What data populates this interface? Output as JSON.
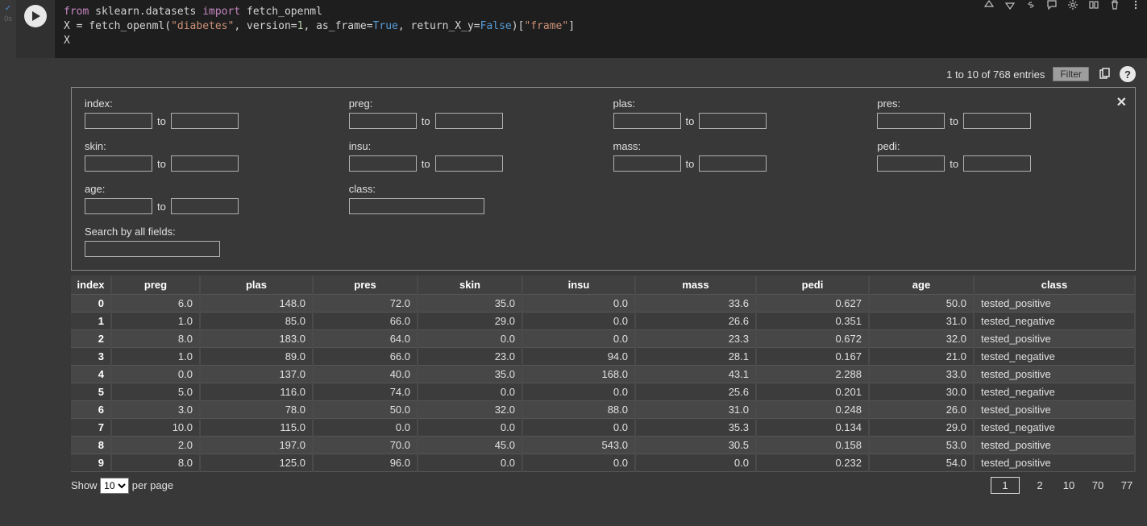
{
  "gutter": {
    "check": "✓",
    "time": "0s"
  },
  "code": {
    "line1_pre": "from",
    "line1_mod": " sklearn.datasets ",
    "line1_imp": "import",
    "line1_fn": " fetch_openml",
    "line2_a": "X = fetch_openml(",
    "line2_s1": "\"diabetes\"",
    "line2_b": ", version=",
    "line2_n1": "1",
    "line2_c": ", as_frame=",
    "line2_t": "True",
    "line2_d": ", return_X_y=",
    "line2_f": "False",
    "line2_e": ")[",
    "line2_s2": "\"frame\"",
    "line2_g": "]",
    "line3": "X"
  },
  "output_header": {
    "entries_text": "1 to 10 of 768 entries",
    "filter_label": "Filter"
  },
  "filters": {
    "range_labels": [
      "index:",
      "preg:",
      "plas:",
      "pres:",
      "skin:",
      "insu:",
      "mass:",
      "pedi:",
      "age:"
    ],
    "to_label": "to",
    "single_labels": [
      "class:"
    ],
    "search_label": "Search by all fields:"
  },
  "table": {
    "columns": [
      "index",
      "preg",
      "plas",
      "pres",
      "skin",
      "insu",
      "mass",
      "pedi",
      "age",
      "class"
    ],
    "col_widths": [
      "50px",
      "110px",
      "140px",
      "130px",
      "130px",
      "140px",
      "150px",
      "140px",
      "130px",
      ""
    ],
    "rows": [
      {
        "index": "0",
        "preg": "6.0",
        "plas": "148.0",
        "pres": "72.0",
        "skin": "35.0",
        "insu": "0.0",
        "mass": "33.6",
        "pedi": "0.627",
        "age": "50.0",
        "class": "tested_positive"
      },
      {
        "index": "1",
        "preg": "1.0",
        "plas": "85.0",
        "pres": "66.0",
        "skin": "29.0",
        "insu": "0.0",
        "mass": "26.6",
        "pedi": "0.351",
        "age": "31.0",
        "class": "tested_negative"
      },
      {
        "index": "2",
        "preg": "8.0",
        "plas": "183.0",
        "pres": "64.0",
        "skin": "0.0",
        "insu": "0.0",
        "mass": "23.3",
        "pedi": "0.672",
        "age": "32.0",
        "class": "tested_positive"
      },
      {
        "index": "3",
        "preg": "1.0",
        "plas": "89.0",
        "pres": "66.0",
        "skin": "23.0",
        "insu": "94.0",
        "mass": "28.1",
        "pedi": "0.167",
        "age": "21.0",
        "class": "tested_negative"
      },
      {
        "index": "4",
        "preg": "0.0",
        "plas": "137.0",
        "pres": "40.0",
        "skin": "35.0",
        "insu": "168.0",
        "mass": "43.1",
        "pedi": "2.288",
        "age": "33.0",
        "class": "tested_positive"
      },
      {
        "index": "5",
        "preg": "5.0",
        "plas": "116.0",
        "pres": "74.0",
        "skin": "0.0",
        "insu": "0.0",
        "mass": "25.6",
        "pedi": "0.201",
        "age": "30.0",
        "class": "tested_negative"
      },
      {
        "index": "6",
        "preg": "3.0",
        "plas": "78.0",
        "pres": "50.0",
        "skin": "32.0",
        "insu": "88.0",
        "mass": "31.0",
        "pedi": "0.248",
        "age": "26.0",
        "class": "tested_positive"
      },
      {
        "index": "7",
        "preg": "10.0",
        "plas": "115.0",
        "pres": "0.0",
        "skin": "0.0",
        "insu": "0.0",
        "mass": "35.3",
        "pedi": "0.134",
        "age": "29.0",
        "class": "tested_negative"
      },
      {
        "index": "8",
        "preg": "2.0",
        "plas": "197.0",
        "pres": "70.0",
        "skin": "45.0",
        "insu": "543.0",
        "mass": "30.5",
        "pedi": "0.158",
        "age": "53.0",
        "class": "tested_positive"
      },
      {
        "index": "9",
        "preg": "8.0",
        "plas": "125.0",
        "pres": "96.0",
        "skin": "0.0",
        "insu": "0.0",
        "mass": "0.0",
        "pedi": "0.232",
        "age": "54.0",
        "class": "tested_positive"
      }
    ]
  },
  "footer": {
    "show_label_pre": "Show",
    "show_label_post": "per page",
    "page_size_options": [
      "10"
    ],
    "page_size_value": "10",
    "pages": [
      "1",
      "2",
      "10",
      "70",
      "77"
    ],
    "active_page": "1"
  }
}
